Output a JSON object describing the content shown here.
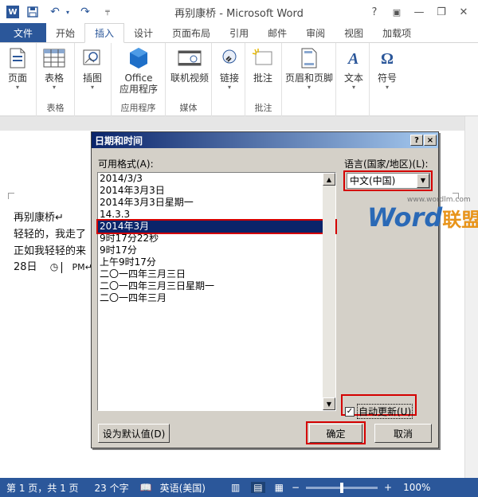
{
  "window": {
    "title": "再别康桥 - Microsoft Word",
    "help": "?",
    "minimize": "—",
    "restore": "❐",
    "close": "✕"
  },
  "tabs": [
    "文件",
    "开始",
    "插入",
    "设计",
    "页面布局",
    "引用",
    "邮件",
    "审阅",
    "视图",
    "加载项"
  ],
  "active_tab": "插入",
  "ribbon": {
    "groups": [
      {
        "label": "",
        "buttons": [
          {
            "label": "页面",
            "icon": "page-icon"
          }
        ]
      },
      {
        "label": "表格",
        "buttons": [
          {
            "label": "表格",
            "icon": "table-icon"
          }
        ]
      },
      {
        "label": "",
        "buttons": [
          {
            "label": "插图",
            "icon": "illustration-icon"
          }
        ]
      },
      {
        "label": "应用程序",
        "buttons": [
          {
            "label": "Office\n应用程序",
            "icon": "office-apps-icon"
          }
        ]
      },
      {
        "label": "媒体",
        "buttons": [
          {
            "label": "联机视频",
            "icon": "online-video-icon"
          }
        ]
      },
      {
        "label": "",
        "buttons": [
          {
            "label": "链接",
            "icon": "link-icon"
          }
        ]
      },
      {
        "label": "批注",
        "buttons": [
          {
            "label": "批注",
            "icon": "comment-icon"
          }
        ]
      },
      {
        "label": "",
        "buttons": [
          {
            "label": "页眉和页脚",
            "icon": "header-footer-icon"
          }
        ]
      },
      {
        "label": "",
        "buttons": [
          {
            "label": "文本",
            "icon": "text-icon"
          }
        ]
      },
      {
        "label": "",
        "buttons": [
          {
            "label": "符号",
            "icon": "symbol-icon"
          }
        ]
      }
    ]
  },
  "document": {
    "lines": [
      "再别康桥↵",
      "轻轻的，我走了",
      "正如我轻轻的来",
      "28日"
    ],
    "field_suffix": "PM↵"
  },
  "dialog": {
    "title": "日期和时间",
    "help_btn": "?",
    "close_btn": "×",
    "formats_label": "可用格式(A):",
    "formats": [
      "2014/3/3",
      "2014年3月3日",
      "2014年3月3日星期一",
      "14.3.3",
      "2014年3月",
      "9时17分22秒",
      "9时17分",
      "上午9时17分",
      "二〇一四年三月三日",
      "二〇一四年三月三日星期一",
      "二〇一四年三月"
    ],
    "selected_index": 4,
    "language_label": "语言(国家/地区)(L):",
    "language_value": "中文(中国)",
    "auto_update_label": "自动更新(U)",
    "auto_update_checked": true,
    "set_default_label": "设为默认值(D)",
    "ok_label": "确定",
    "cancel_label": "取消"
  },
  "watermark": {
    "word": "Word",
    "brand": "联盟",
    "url": "www.wordlm.com"
  },
  "statusbar": {
    "page": "第 1 页，共 1 页",
    "words": "23 个字",
    "language": "英语(美国)",
    "zoom": "100%",
    "zoom_level": 100
  },
  "colors": {
    "accent": "#2b579a",
    "highlight_red": "#d40000",
    "dialog_face": "#d4d0c8",
    "selection": "#0a246a"
  }
}
